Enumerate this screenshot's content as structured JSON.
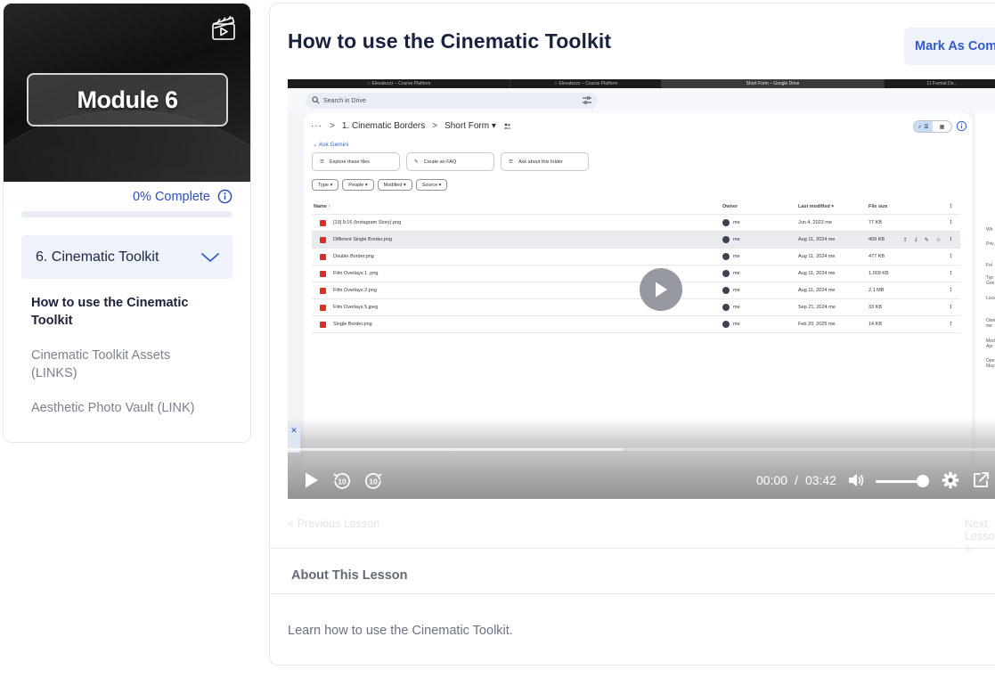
{
  "sidebar": {
    "module_title": "Module 6",
    "progress_label": "0% Complete",
    "progress_value": 0,
    "section_title": "6. Cinematic Toolkit",
    "lessons": [
      {
        "label": "How to use the Cinematic Toolkit",
        "active": true
      },
      {
        "label": "Cinematic Toolkit Assets (LINKS)",
        "active": false
      },
      {
        "label": "Aesthetic Photo Vault (LINK)",
        "active": false
      }
    ]
  },
  "main": {
    "title": "How to use the Cinematic Toolkit",
    "complete_button": "Mark As Complete",
    "prev_label": "< Previous Lesson",
    "next_label": "Next Lesson >",
    "about_heading": "About This Lesson",
    "about_text": "Learn how to use the Cinematic Toolkit."
  },
  "video": {
    "current_time": "00:00",
    "separator": "/",
    "duration": "03:42",
    "buffered_fraction": 0.47,
    "volume_fraction": 0.84,
    "screen": {
      "tabs": [
        "☆ Elevatezzz – Course Platform",
        "☆ Elevatezzz – Course Platform",
        "Short Form – Google Drive",
        "11 Format De..."
      ],
      "search_placeholder": "Search in Drive",
      "breadcrumb": [
        "···",
        ">",
        "1. Cinematic Borders",
        ">",
        "Short Form ▾"
      ],
      "ask_gemini": "Ask Gemini",
      "chips": [
        "Explore these files",
        "Create an FAQ",
        "Ask about this folder"
      ],
      "filters": [
        "Type ▾",
        "People ▾",
        "Modified ▾",
        "Source ▾"
      ],
      "columns": {
        "name": "Name  ↑",
        "owner": "Owner",
        "modified": "Last modified ▾",
        "size": "File size",
        "menu": "⋮"
      },
      "rows": [
        {
          "name": "[19] 9:16 (Instagram Story).png",
          "owner": "me",
          "modified": "Jun 4, 2023 me",
          "size": "77 KB"
        },
        {
          "name": "Different Single Border.png",
          "owner": "me",
          "modified": "Aug 11, 2024 me",
          "size": "409 KB"
        },
        {
          "name": "Double Border.png",
          "owner": "me",
          "modified": "Aug 11, 2024 me",
          "size": "477 KB"
        },
        {
          "name": "Film Overlays 1 .png",
          "owner": "me",
          "modified": "Aug 11, 2024 me",
          "size": "1,009 KB"
        },
        {
          "name": "Film Overlays 2.png",
          "owner": "me",
          "modified": "Aug 11, 2024 me",
          "size": "2.1 MB"
        },
        {
          "name": "Film Overlays 5.jpeg",
          "owner": "me",
          "modified": "Sep 21, 2024 me",
          "size": "33 KB"
        },
        {
          "name": "Single Border.png",
          "owner": "me",
          "modified": "Feb 20, 2025 me",
          "size": "14 KB"
        }
      ],
      "side_labels": [
        "Wh",
        "Priv",
        "Fol",
        "Typ",
        "Goo",
        "Loca",
        "Own",
        "me",
        "Mod",
        "Apr",
        "Ope",
        "May"
      ]
    }
  },
  "colors": {
    "accent": "#2c4fbd",
    "section_bg": "#eef3fb",
    "button_text": "#3359c8"
  }
}
